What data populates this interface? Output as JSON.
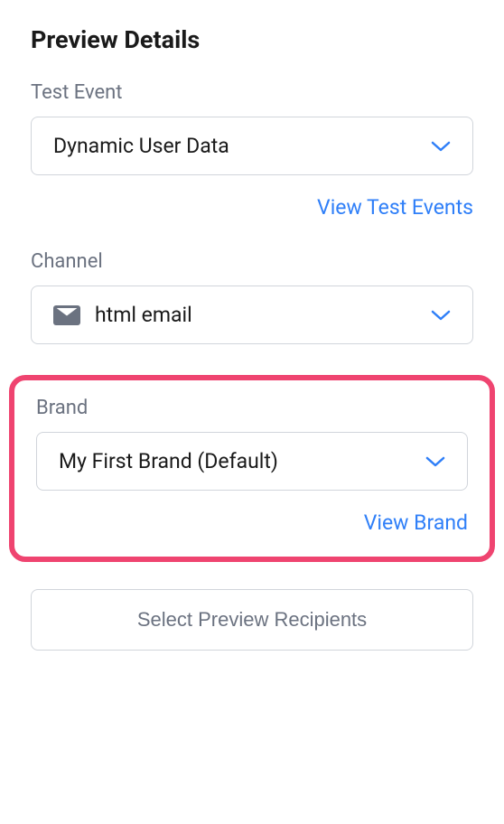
{
  "title": "Preview Details",
  "testEvent": {
    "label": "Test Event",
    "selected": "Dynamic User Data",
    "link": "View Test Events"
  },
  "channel": {
    "label": "Channel",
    "selected": "html email",
    "icon": "email-icon"
  },
  "brand": {
    "label": "Brand",
    "selected": "My First Brand (Default)",
    "link": "View Brand"
  },
  "recipientsButton": "Select Preview Recipients",
  "colors": {
    "highlight": "#ef4470",
    "link": "#2f7ff8",
    "muted": "#6b7280"
  }
}
